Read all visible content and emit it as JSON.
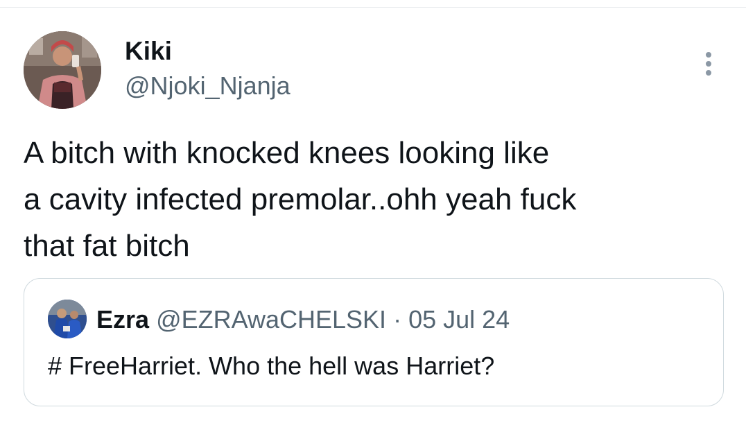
{
  "tweet": {
    "author": {
      "display_name": "Kiki",
      "handle": "@Njoki_Njanja"
    },
    "text": "A bitch with knocked knees looking like\na cavity infected premolar..ohh yeah fuck\nthat fat bitch",
    "more_icon": "more-vertical-icon"
  },
  "quote": {
    "author": {
      "display_name": "Ezra",
      "handle": "@EZRAwaCHELSKI"
    },
    "separator": "·",
    "date": "05 Jul 24",
    "text": "# FreeHarriet. Who the hell was Harriet?"
  },
  "colors": {
    "text": "#0f1419",
    "secondary_text": "#536471",
    "border": "#cfd9de",
    "more_dots": "#8b98a5"
  }
}
